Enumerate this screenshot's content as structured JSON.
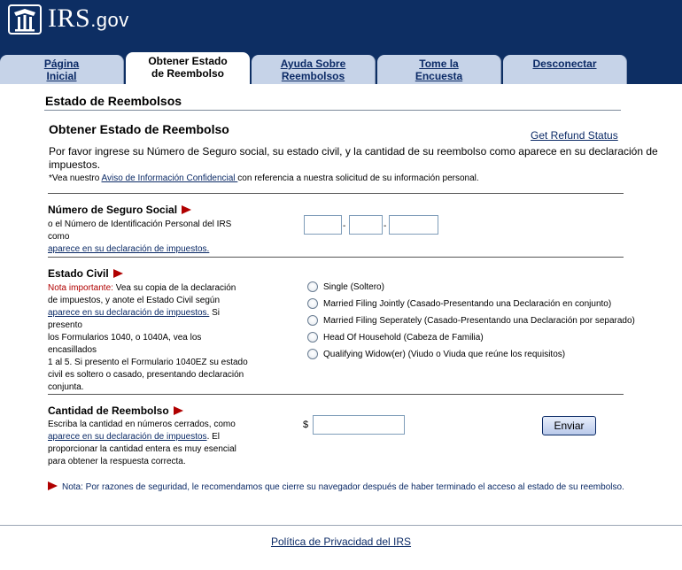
{
  "header": {
    "logo_text": "IRS",
    "logo_suffix": ".gov",
    "logo_icon": "irs-eagle-logo-icon"
  },
  "tabs": [
    {
      "line1": "Página",
      "line2": "Inicial"
    },
    {
      "line1": "Obtener Estado",
      "line2": "de Reembolso",
      "active": true
    },
    {
      "line1": "Ayuda Sobre",
      "line2": "Reembolsos"
    },
    {
      "line1": "Tome la",
      "line2": "Encuesta"
    },
    {
      "line1": "Desconectar",
      "line2": ""
    }
  ],
  "page": {
    "heading": "Estado de Reembolsos",
    "section_title": "Obtener Estado de Reembolso",
    "english_link": "Get Refund Status",
    "intro": "Por favor ingrese su Número de Seguro social, su estado civil, y la cantidad de su reembolso como aparece en su declaración de impuestos.",
    "privacy_prefix": "*Vea nuestro ",
    "privacy_link": "Aviso de Información Confidencial ",
    "privacy_suffix": "con referencia a nuestra solicitud de su información personal."
  },
  "ssn": {
    "title": "Número de Seguro Social",
    "desc1": "o el Número de Identificación Personal del IRS",
    "desc2": "como",
    "link": "aparece en su declaración de impuestos.",
    "separator": "-"
  },
  "filing_status": {
    "title": "Estado Civil",
    "important_label": "Nota importante:",
    "desc1": " Vea su copia de la declaración",
    "desc2": "de impuestos, y anote el Estado Civil según",
    "link": "aparece en su declaración de impuestos.",
    "desc3": " Si",
    "desc4": "presento",
    "desc5": "los Formularios 1040, o 1040A, vea los",
    "desc6": "encasillados",
    "desc7": "1 al 5. Si presento el Formulario 1040EZ su estado",
    "desc8": "civil es soltero o casado, presentando declaración",
    "desc9": "conjunta.",
    "options": [
      "Single (Soltero)",
      "Married Filing Jointly (Casado-Presentando una Declaración en conjunto)",
      "Married Filing Seperately (Casado-Presentando una Declaración por separado)",
      "Head Of Household (Cabeza de Familia)",
      "Qualifying Widow(er) (Viudo o Viuda que reúne los requisitos)"
    ]
  },
  "amount": {
    "title": "Cantidad de Reembolso",
    "desc1": "Escriba la cantidad en números cerrados, como",
    "link": "aparece en su declaración de impuestos",
    "desc2": ". El",
    "desc3": "proporcionar la cantidad entera es muy esencial",
    "desc4": "para obtener la respuesta correcta.",
    "currency": "$",
    "submit_label": "Enviar"
  },
  "security_note": "Nota: Por razones de seguridad, le recomendamos que cierre su navegador después de haber terminado el acceso al estado de su reembolso.",
  "footer": {
    "privacy_policy": "Política de Privacidad del IRS"
  },
  "colors": {
    "header_bg": "#0d2e63",
    "tab_bg": "#c6d3e8",
    "link": "#0b2a66",
    "arrow": "#b00000"
  }
}
